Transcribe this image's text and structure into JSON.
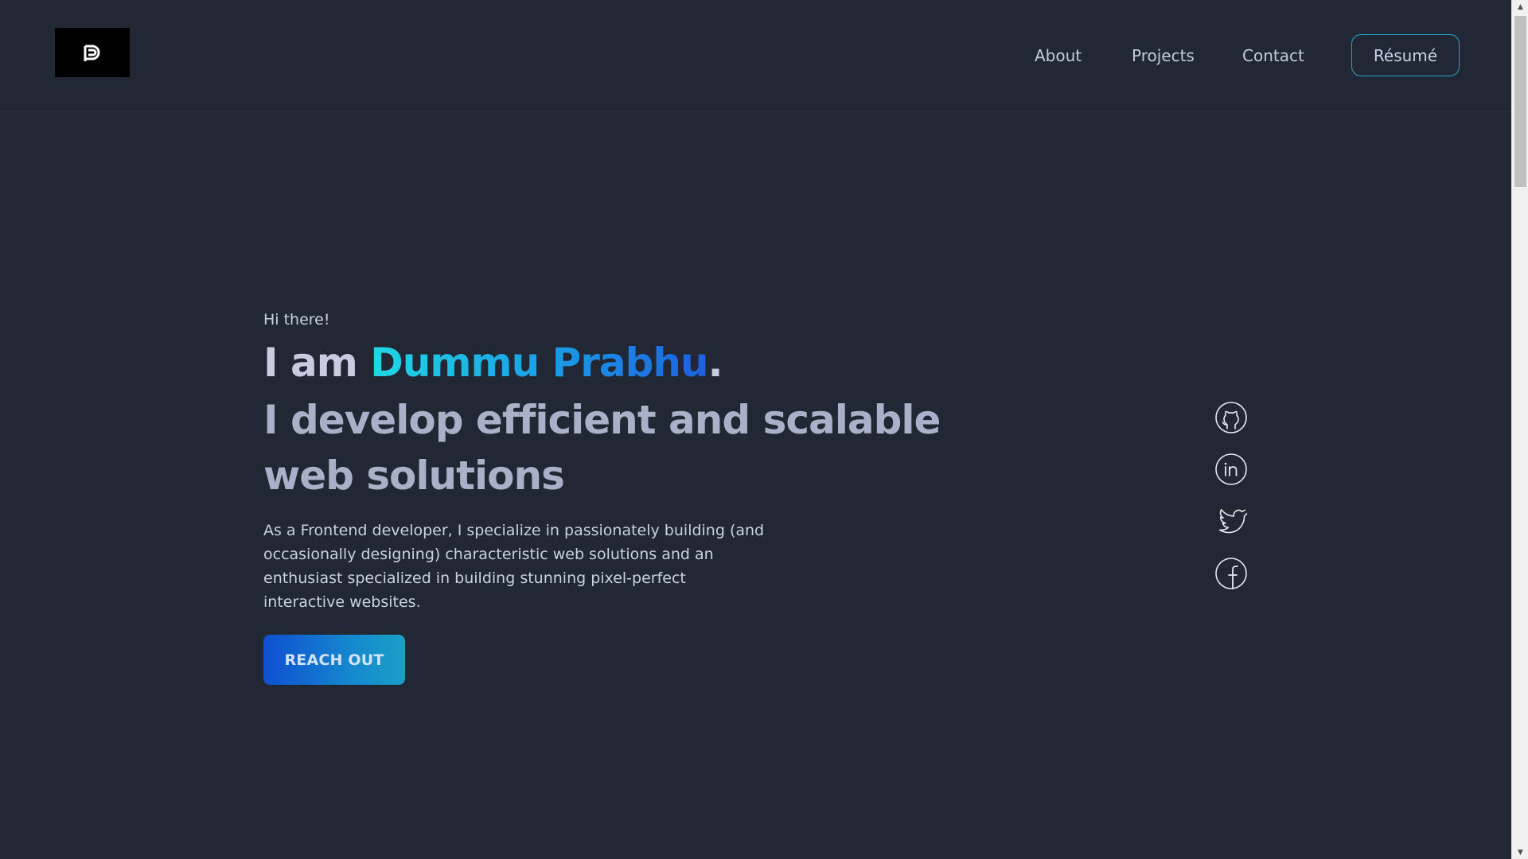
{
  "header": {
    "logo_alt": "logo",
    "nav": {
      "about": "About",
      "projects": "Projects",
      "contact": "Contact"
    },
    "resume_label": "Résumé"
  },
  "hero": {
    "greeting": "Hi there!",
    "headline_prefix": "I am ",
    "name": "Dummu Prabhu",
    "headline_suffix": ".",
    "tagline_line1": "I develop efficient and scalable",
    "tagline_line2": "web solutions",
    "description": "As a Frontend developer, I specialize in passionately building (and occasionally designing) characteristic web solutions and an enthusiast specialized in building stunning pixel-perfect interactive websites.",
    "cta_label": "REACH OUT"
  },
  "social": [
    {
      "icon": "github-icon"
    },
    {
      "icon": "linkedin-icon"
    },
    {
      "icon": "twitter-icon"
    },
    {
      "icon": "facebook-icon"
    }
  ],
  "colors": {
    "background": "#212733",
    "accent_cyan": "#21d8e4",
    "accent_blue": "#1e5fe0",
    "resume_border": "#2aa3d8"
  }
}
